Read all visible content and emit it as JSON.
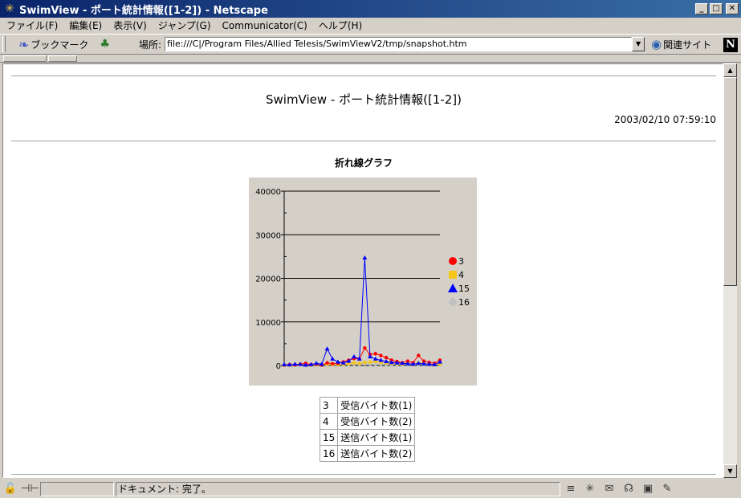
{
  "window": {
    "title": "SwimView - ポート統計情報([1-2]) - Netscape"
  },
  "menu": {
    "items": [
      "ファイル(F)",
      "編集(E)",
      "表示(V)",
      "ジャンプ(G)",
      "Communicator(C)",
      "ヘルプ(H)"
    ]
  },
  "toolbar": {
    "bookmarks_label": "ブックマーク",
    "location_label": "場所:",
    "location_value": "file:///C|/Program Files/Allied Telesis/SwimViewV2/tmp/snapshot.htm",
    "related_label": "関連サイト"
  },
  "page": {
    "heading": "SwimView - ポート統計情報([1-2])",
    "timestamp": "2003/02/10 07:59:10",
    "chart_heading": "折れ線グラフ"
  },
  "legend_table": [
    {
      "port": "3",
      "desc": "受信バイト数(1)"
    },
    {
      "port": "4",
      "desc": "受信バイト数(2)"
    },
    {
      "port": "15",
      "desc": "送信バイト数(1)"
    },
    {
      "port": "16",
      "desc": "送信バイト数(2)"
    }
  ],
  "status": {
    "text": "ドキュメント: 完了。"
  },
  "chart_data": {
    "type": "line",
    "title": "",
    "xlabel": "",
    "ylabel": "",
    "ylim": [
      0,
      40000
    ],
    "yticks": [
      0,
      10000,
      20000,
      30000,
      40000
    ],
    "grid": true,
    "legend_position": "right",
    "x": [
      1,
      2,
      3,
      4,
      5,
      6,
      7,
      8,
      9,
      10,
      11,
      12,
      13,
      14,
      15,
      16,
      17,
      18,
      19,
      20,
      21,
      22,
      23,
      24,
      25,
      26,
      27,
      28,
      29,
      30
    ],
    "series": [
      {
        "name": "3",
        "color": "#ff0000",
        "marker": "circle",
        "values": [
          100,
          200,
          150,
          300,
          500,
          200,
          300,
          100,
          600,
          400,
          500,
          800,
          1200,
          1600,
          1500,
          4000,
          2500,
          2700,
          2300,
          1800,
          1200,
          900,
          600,
          1000,
          600,
          2300,
          1000,
          700,
          500,
          1200
        ]
      },
      {
        "name": "4",
        "color": "#f5c518",
        "marker": "square",
        "values": [
          50,
          100,
          80,
          200,
          150,
          100,
          200,
          80,
          300,
          250,
          200,
          300,
          400,
          600,
          500,
          700,
          800,
          900,
          700,
          600,
          500,
          400,
          300,
          500,
          200,
          600,
          400,
          300,
          200,
          300
        ]
      },
      {
        "name": "15",
        "color": "#0000ff",
        "marker": "triangle",
        "values": [
          200,
          150,
          300,
          250,
          100,
          200,
          500,
          300,
          3800,
          1500,
          800,
          600,
          1000,
          2000,
          1500,
          24700,
          2000,
          1500,
          1200,
          900,
          700,
          600,
          500,
          400,
          300,
          500,
          400,
          300,
          200,
          800
        ]
      },
      {
        "name": "16",
        "color": "#c0c0c0",
        "marker": "diamond",
        "values": [
          100,
          100,
          100,
          150,
          100,
          100,
          150,
          100,
          200,
          150,
          150,
          200,
          250,
          300,
          300,
          400,
          350,
          300,
          300,
          250,
          200,
          200,
          150,
          200,
          150,
          250,
          200,
          150,
          150,
          200
        ]
      }
    ]
  }
}
